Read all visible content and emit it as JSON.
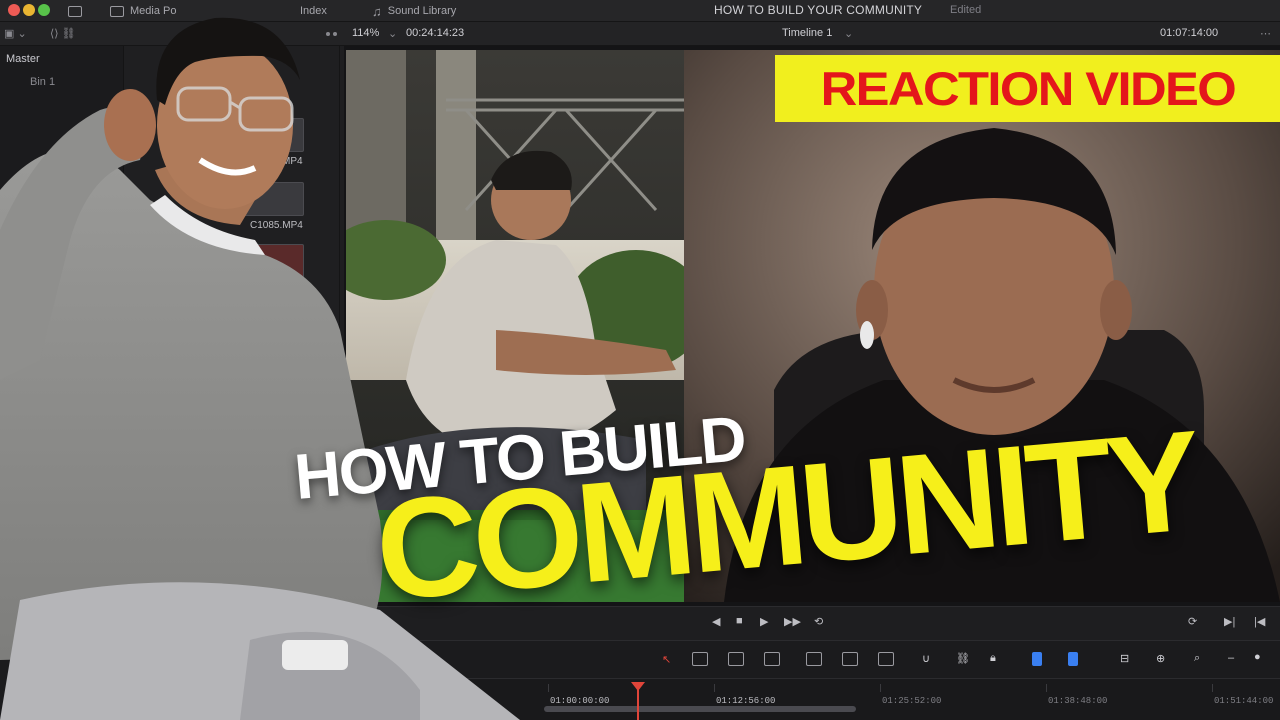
{
  "window": {
    "project_title": "HOW TO BUILD YOUR COMMUNITY",
    "project_status": "Edited"
  },
  "topbar": {
    "media_pool_label": "Media Po",
    "index_label": "Index",
    "sound_library_label": "Sound Library"
  },
  "viewer_bar": {
    "zoom": "114%",
    "source_timecode": "00:24:14:23",
    "timeline_name": "Timeline 1",
    "record_timecode": "01:07:14:00"
  },
  "media_pool": {
    "bins": [
      "Master",
      "Bin 1"
    ],
    "clips": [
      {
        "name": "MP4"
      },
      {
        "name": "C1085.MP4"
      }
    ]
  },
  "timeline": {
    "timecodes": [
      "01:00:00:00",
      "01:12:56:00",
      "01:25:52:00",
      "01:38:48:00",
      "01:51:44:00"
    ]
  },
  "overlay": {
    "badge_text": "REACTION VIDEO",
    "headline_line1": "HOW TO BUILD",
    "headline_line2": "COMMUNITY"
  },
  "colors": {
    "badge_bg": "#f1ef1e",
    "badge_text": "#e4161b",
    "headline_accent": "#f6ef1a",
    "playhead": "#e0453a"
  }
}
